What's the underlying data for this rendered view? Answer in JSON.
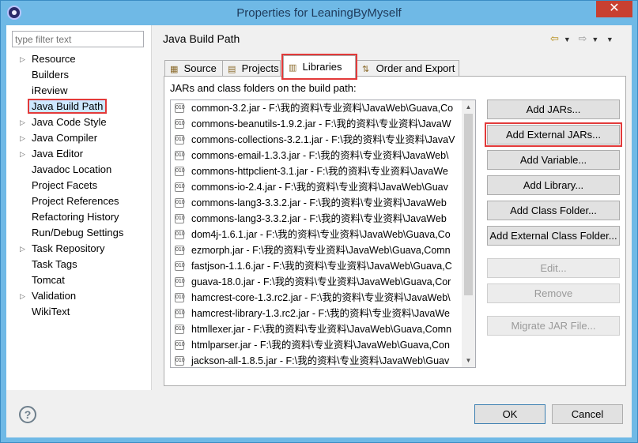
{
  "window": {
    "title": "Properties for LeaningByMyself",
    "close": "✕"
  },
  "filter": {
    "placeholder": "type filter text"
  },
  "nav": [
    {
      "label": "Resource",
      "expandable": true
    },
    {
      "label": "Builders",
      "expandable": false
    },
    {
      "label": "iReview",
      "expandable": false
    },
    {
      "label": "Java Build Path",
      "expandable": false,
      "selected": true
    },
    {
      "label": "Java Code Style",
      "expandable": true
    },
    {
      "label": "Java Compiler",
      "expandable": true
    },
    {
      "label": "Java Editor",
      "expandable": true
    },
    {
      "label": "Javadoc Location",
      "expandable": false
    },
    {
      "label": "Project Facets",
      "expandable": false
    },
    {
      "label": "Project References",
      "expandable": false
    },
    {
      "label": "Refactoring History",
      "expandable": false
    },
    {
      "label": "Run/Debug Settings",
      "expandable": false
    },
    {
      "label": "Task Repository",
      "expandable": true
    },
    {
      "label": "Task Tags",
      "expandable": false
    },
    {
      "label": "Tomcat",
      "expandable": false
    },
    {
      "label": "Validation",
      "expandable": true
    },
    {
      "label": "WikiText",
      "expandable": false
    }
  ],
  "page": {
    "title": "Java Build Path"
  },
  "tabs": [
    {
      "label": "Source",
      "icon": "source-folder-icon"
    },
    {
      "label": "Projects",
      "icon": "projects-icon"
    },
    {
      "label": "Libraries",
      "icon": "libraries-icon",
      "active": true
    },
    {
      "label": "Order and Export",
      "icon": "order-export-icon"
    }
  ],
  "libraries": {
    "caption": "JARs and class folders on the build path:",
    "jars": [
      "common-3.2.jar - F:\\我的资料\\专业资料\\JavaWeb\\Guava,Co",
      "commons-beanutils-1.9.2.jar - F:\\我的资料\\专业资料\\JavaW",
      "commons-collections-3.2.1.jar - F:\\我的资料\\专业资料\\JavaV",
      "commons-email-1.3.3.jar - F:\\我的资料\\专业资料\\JavaWeb\\",
      "commons-httpclient-3.1.jar - F:\\我的资料\\专业资料\\JavaWe",
      "commons-io-2.4.jar - F:\\我的资料\\专业资料\\JavaWeb\\Guav",
      "commons-lang3-3.3.2.jar - F:\\我的资料\\专业资料\\JavaWeb",
      "commons-lang3-3.3.2.jar - F:\\我的资料\\专业资料\\JavaWeb",
      "dom4j-1.6.1.jar - F:\\我的资料\\专业资料\\JavaWeb\\Guava,Co",
      "ezmorph.jar - F:\\我的资料\\专业资料\\JavaWeb\\Guava,Comn",
      "fastjson-1.1.6.jar - F:\\我的资料\\专业资料\\JavaWeb\\Guava,C",
      "guava-18.0.jar - F:\\我的资料\\专业资料\\JavaWeb\\Guava,Cor",
      "hamcrest-core-1.3.rc2.jar - F:\\我的资料\\专业资料\\JavaWeb\\",
      "hamcrest-library-1.3.rc2.jar - F:\\我的资料\\专业资料\\JavaWe",
      "htmllexer.jar - F:\\我的资料\\专业资料\\JavaWeb\\Guava,Comn",
      "htmlparser.jar - F:\\我的资料\\专业资料\\JavaWeb\\Guava,Con",
      "jackson-all-1.8.5.jar - F:\\我的资料\\专业资料\\JavaWeb\\Guav"
    ]
  },
  "buttons": {
    "add_jars": "Add JARs...",
    "add_external_jars": "Add External JARs...",
    "add_variable": "Add Variable...",
    "add_library": "Add Library...",
    "add_class_folder": "Add Class Folder...",
    "add_external_class_folder": "Add External Class Folder...",
    "edit": "Edit...",
    "remove": "Remove",
    "migrate_jar": "Migrate JAR File..."
  },
  "footer": {
    "ok": "OK",
    "cancel": "Cancel"
  }
}
